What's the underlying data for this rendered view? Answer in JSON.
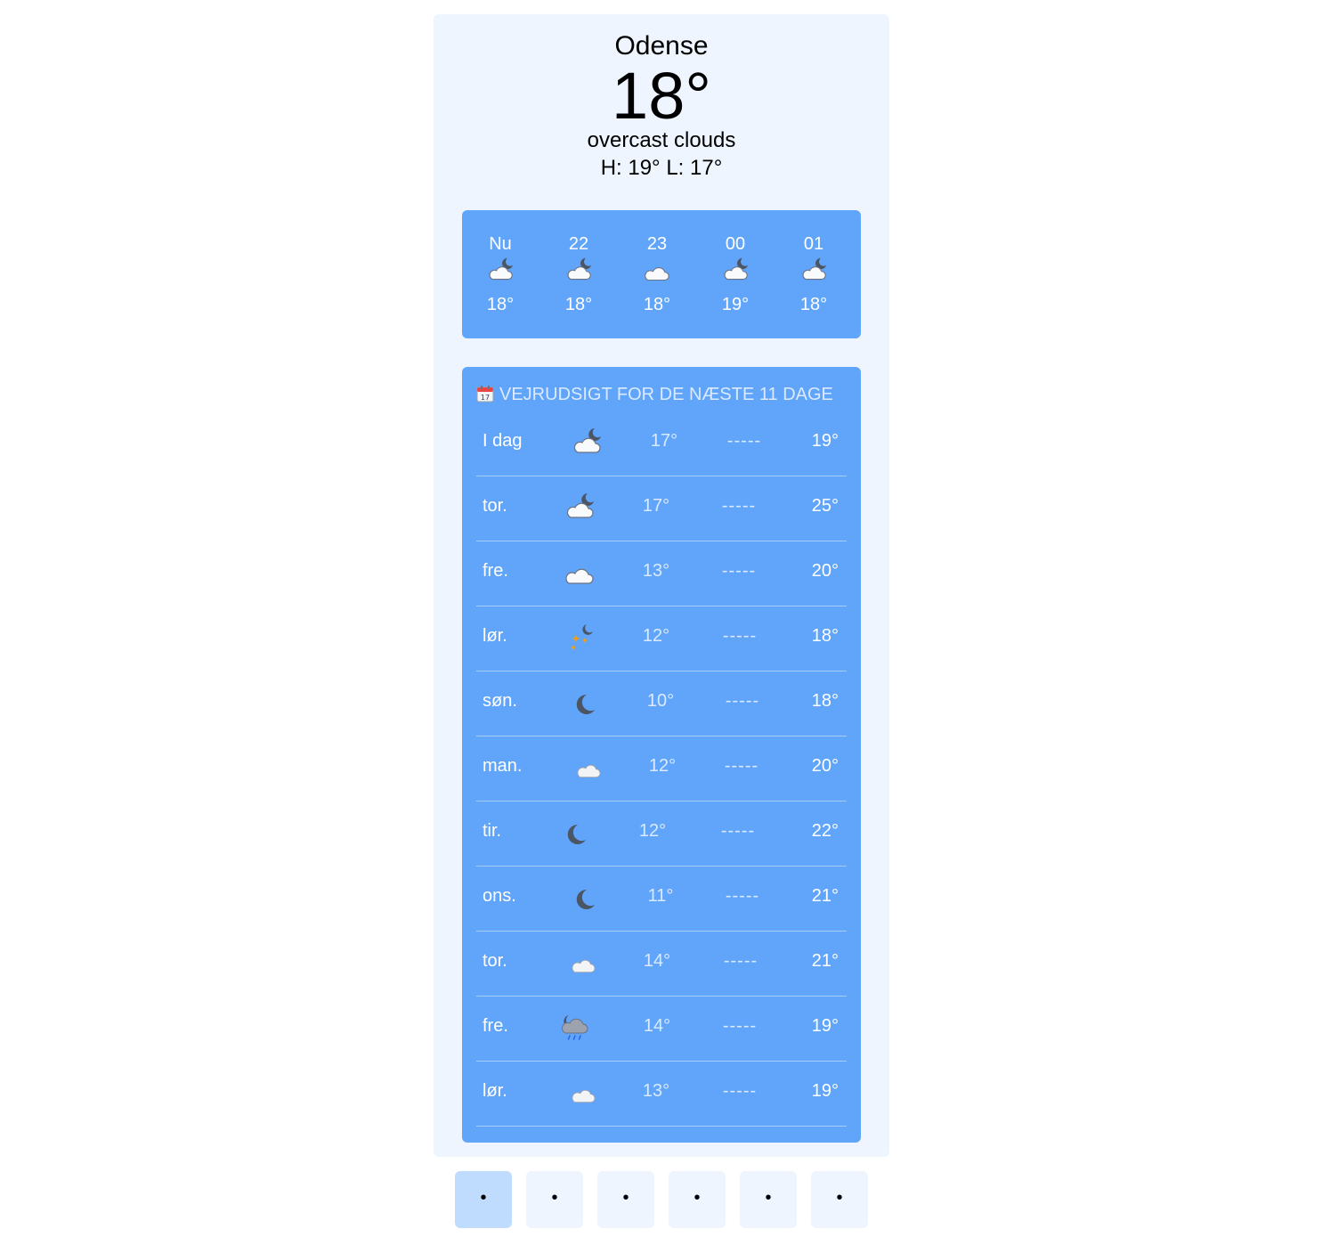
{
  "current": {
    "city": "Odense",
    "temperature": "18°",
    "description": "overcast clouds",
    "high_low": "H: 19° L: 17°"
  },
  "hourly": [
    {
      "time": "Nu",
      "icon": "cloud-moon-icon",
      "temp": "18°"
    },
    {
      "time": "22",
      "icon": "cloud-moon-icon",
      "temp": "18°"
    },
    {
      "time": "23",
      "icon": "cloud-icon",
      "temp": "18°"
    },
    {
      "time": "00",
      "icon": "cloud-moon-icon",
      "temp": "19°"
    },
    {
      "time": "01",
      "icon": "cloud-moon-icon",
      "temp": "18°"
    }
  ],
  "daily": {
    "title": "VEJRUDSIGT FOR DE NÆSTE 11 DAGE",
    "title_icon": "calendar-icon",
    "rows": [
      {
        "day": "I dag",
        "icon": "cloud-moon-icon",
        "low": "17°",
        "bar": "-----",
        "high": "19°"
      },
      {
        "day": "tor.",
        "icon": "cloud-moon-icon",
        "low": "17°",
        "bar": "-----",
        "high": "25°"
      },
      {
        "day": "fre.",
        "icon": "cloud-icon",
        "low": "13°",
        "bar": "-----",
        "high": "20°"
      },
      {
        "day": "lør.",
        "icon": "stars-moon-icon",
        "low": "12°",
        "bar": "-----",
        "high": "18°"
      },
      {
        "day": "søn.",
        "icon": "moon-icon",
        "low": "10°",
        "bar": "-----",
        "high": "18°"
      },
      {
        "day": "man.",
        "icon": "moon-cloud-icon",
        "low": "12°",
        "bar": "-----",
        "high": "20°"
      },
      {
        "day": "tir.",
        "icon": "moon-icon",
        "low": "12°",
        "bar": "-----",
        "high": "22°"
      },
      {
        "day": "ons.",
        "icon": "moon-icon",
        "low": "11°",
        "bar": "-----",
        "high": "21°"
      },
      {
        "day": "tor.",
        "icon": "moon-cloud-icon",
        "low": "14°",
        "bar": "-----",
        "high": "21°"
      },
      {
        "day": "fre.",
        "icon": "rain-cloud-icon",
        "low": "14°",
        "bar": "-----",
        "high": "19°"
      },
      {
        "day": "lør.",
        "icon": "moon-cloud-icon",
        "low": "13°",
        "bar": "-----",
        "high": "19°"
      }
    ]
  },
  "pager": {
    "dots": [
      "•",
      "•",
      "•",
      "•",
      "•",
      "•"
    ],
    "active_index": 0
  },
  "colors": {
    "card_bg": "#eef5ff",
    "panel_bg": "#60a5fa",
    "active_dot_bg": "#bfdbfe"
  }
}
